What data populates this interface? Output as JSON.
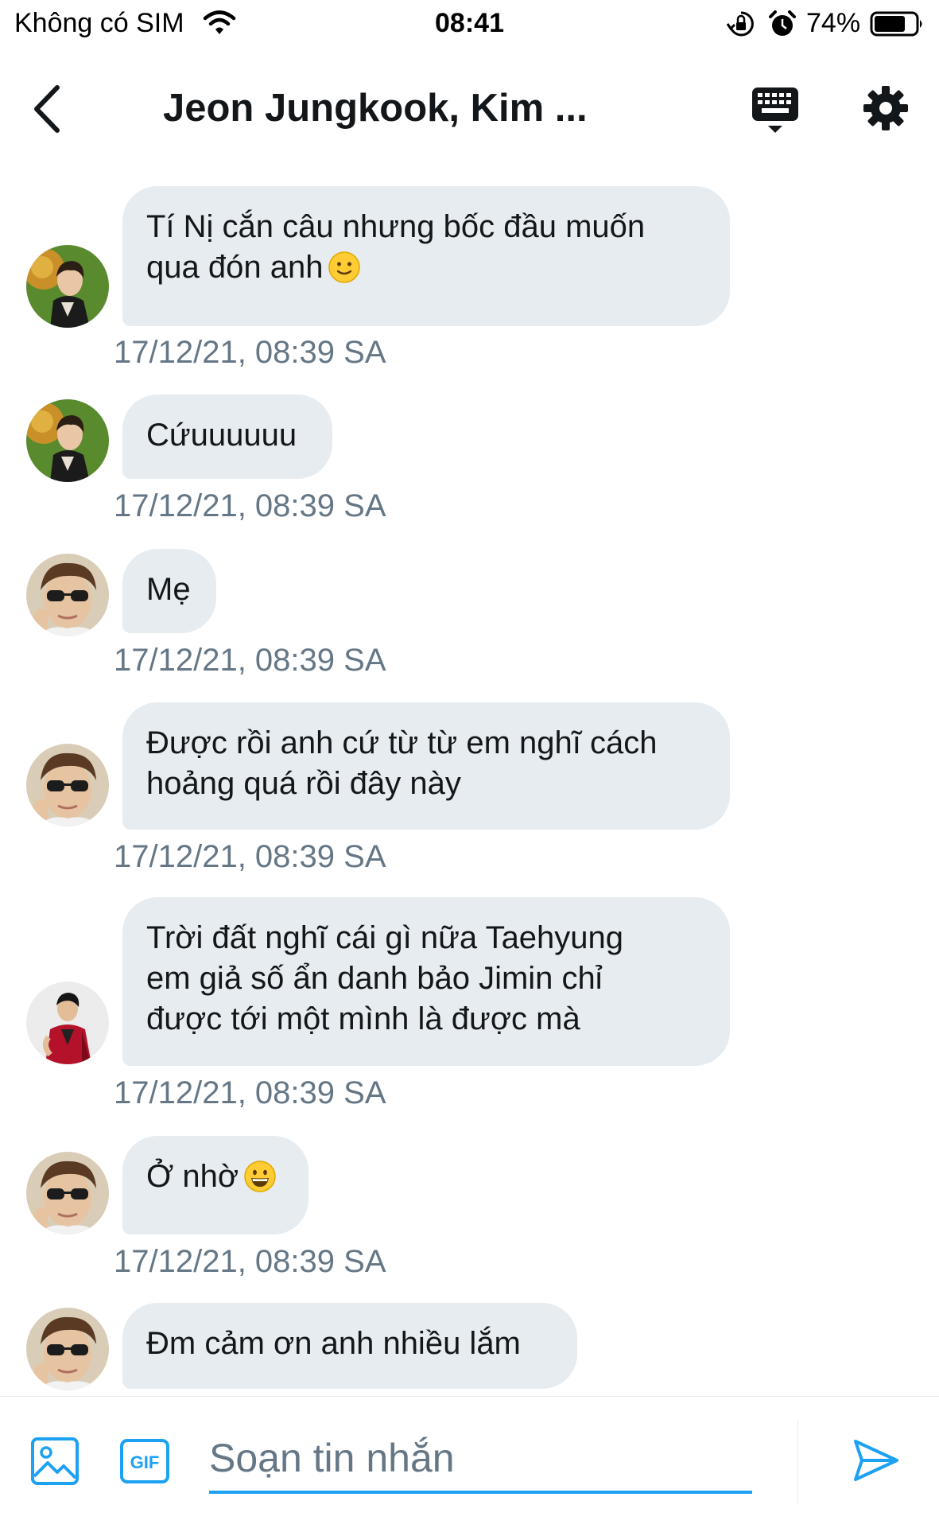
{
  "status_bar": {
    "carrier": "Không có SIM",
    "time": "08:41",
    "battery_percent": "74%",
    "icons": [
      "wifi-icon",
      "rotation-lock-icon",
      "alarm-icon",
      "battery-icon"
    ]
  },
  "header": {
    "title": "Jeon Jungkook, Kim ...",
    "icons": [
      "back-chevron-icon",
      "keyboard-icon",
      "gear-icon"
    ]
  },
  "messages": [
    {
      "text": "Tí Nị cắn câu nhưng bốc đầu muốn\nqua đón anh",
      "emoji": "slightly-smiling-face",
      "avatar": "avatar-green-bg",
      "timestamp": "17/12/21, 08:39 SA"
    },
    {
      "text": "Cứuuuuuu",
      "avatar": "avatar-green-bg",
      "timestamp": "17/12/21, 08:39 SA"
    },
    {
      "text": "Mẹ",
      "avatar": "avatar-sunglasses",
      "timestamp": "17/12/21, 08:39 SA"
    },
    {
      "text": "Được rồi anh cứ từ từ em nghĩ cách\nhoảng quá rồi đây này",
      "avatar": "avatar-sunglasses",
      "timestamp": "17/12/21, 08:39 SA"
    },
    {
      "text": "Trời đất nghĩ cái gì nữa Taehyung\nem giả số ẩn danh bảo Jimin chỉ\nđược tới một mình là được mà",
      "avatar": "avatar-red-jacket",
      "timestamp": "17/12/21, 08:39 SA"
    },
    {
      "text": "Ở nhờ",
      "emoji": "grinning-face",
      "avatar": "avatar-sunglasses",
      "timestamp": "17/12/21, 08:39 SA"
    },
    {
      "text": "Đm cảm ơn anh nhiều lắm",
      "avatar": "avatar-sunglasses"
    }
  ],
  "composer": {
    "placeholder": "Soạn tin nhắn",
    "value": "",
    "icons": [
      "image-icon",
      "gif-icon",
      "send-icon"
    ],
    "gif_label": "GIF"
  },
  "colors": {
    "accent": "#1da1f2",
    "bubble": "#e6ecf0",
    "timestamp": "#657786",
    "text": "#14171a"
  }
}
